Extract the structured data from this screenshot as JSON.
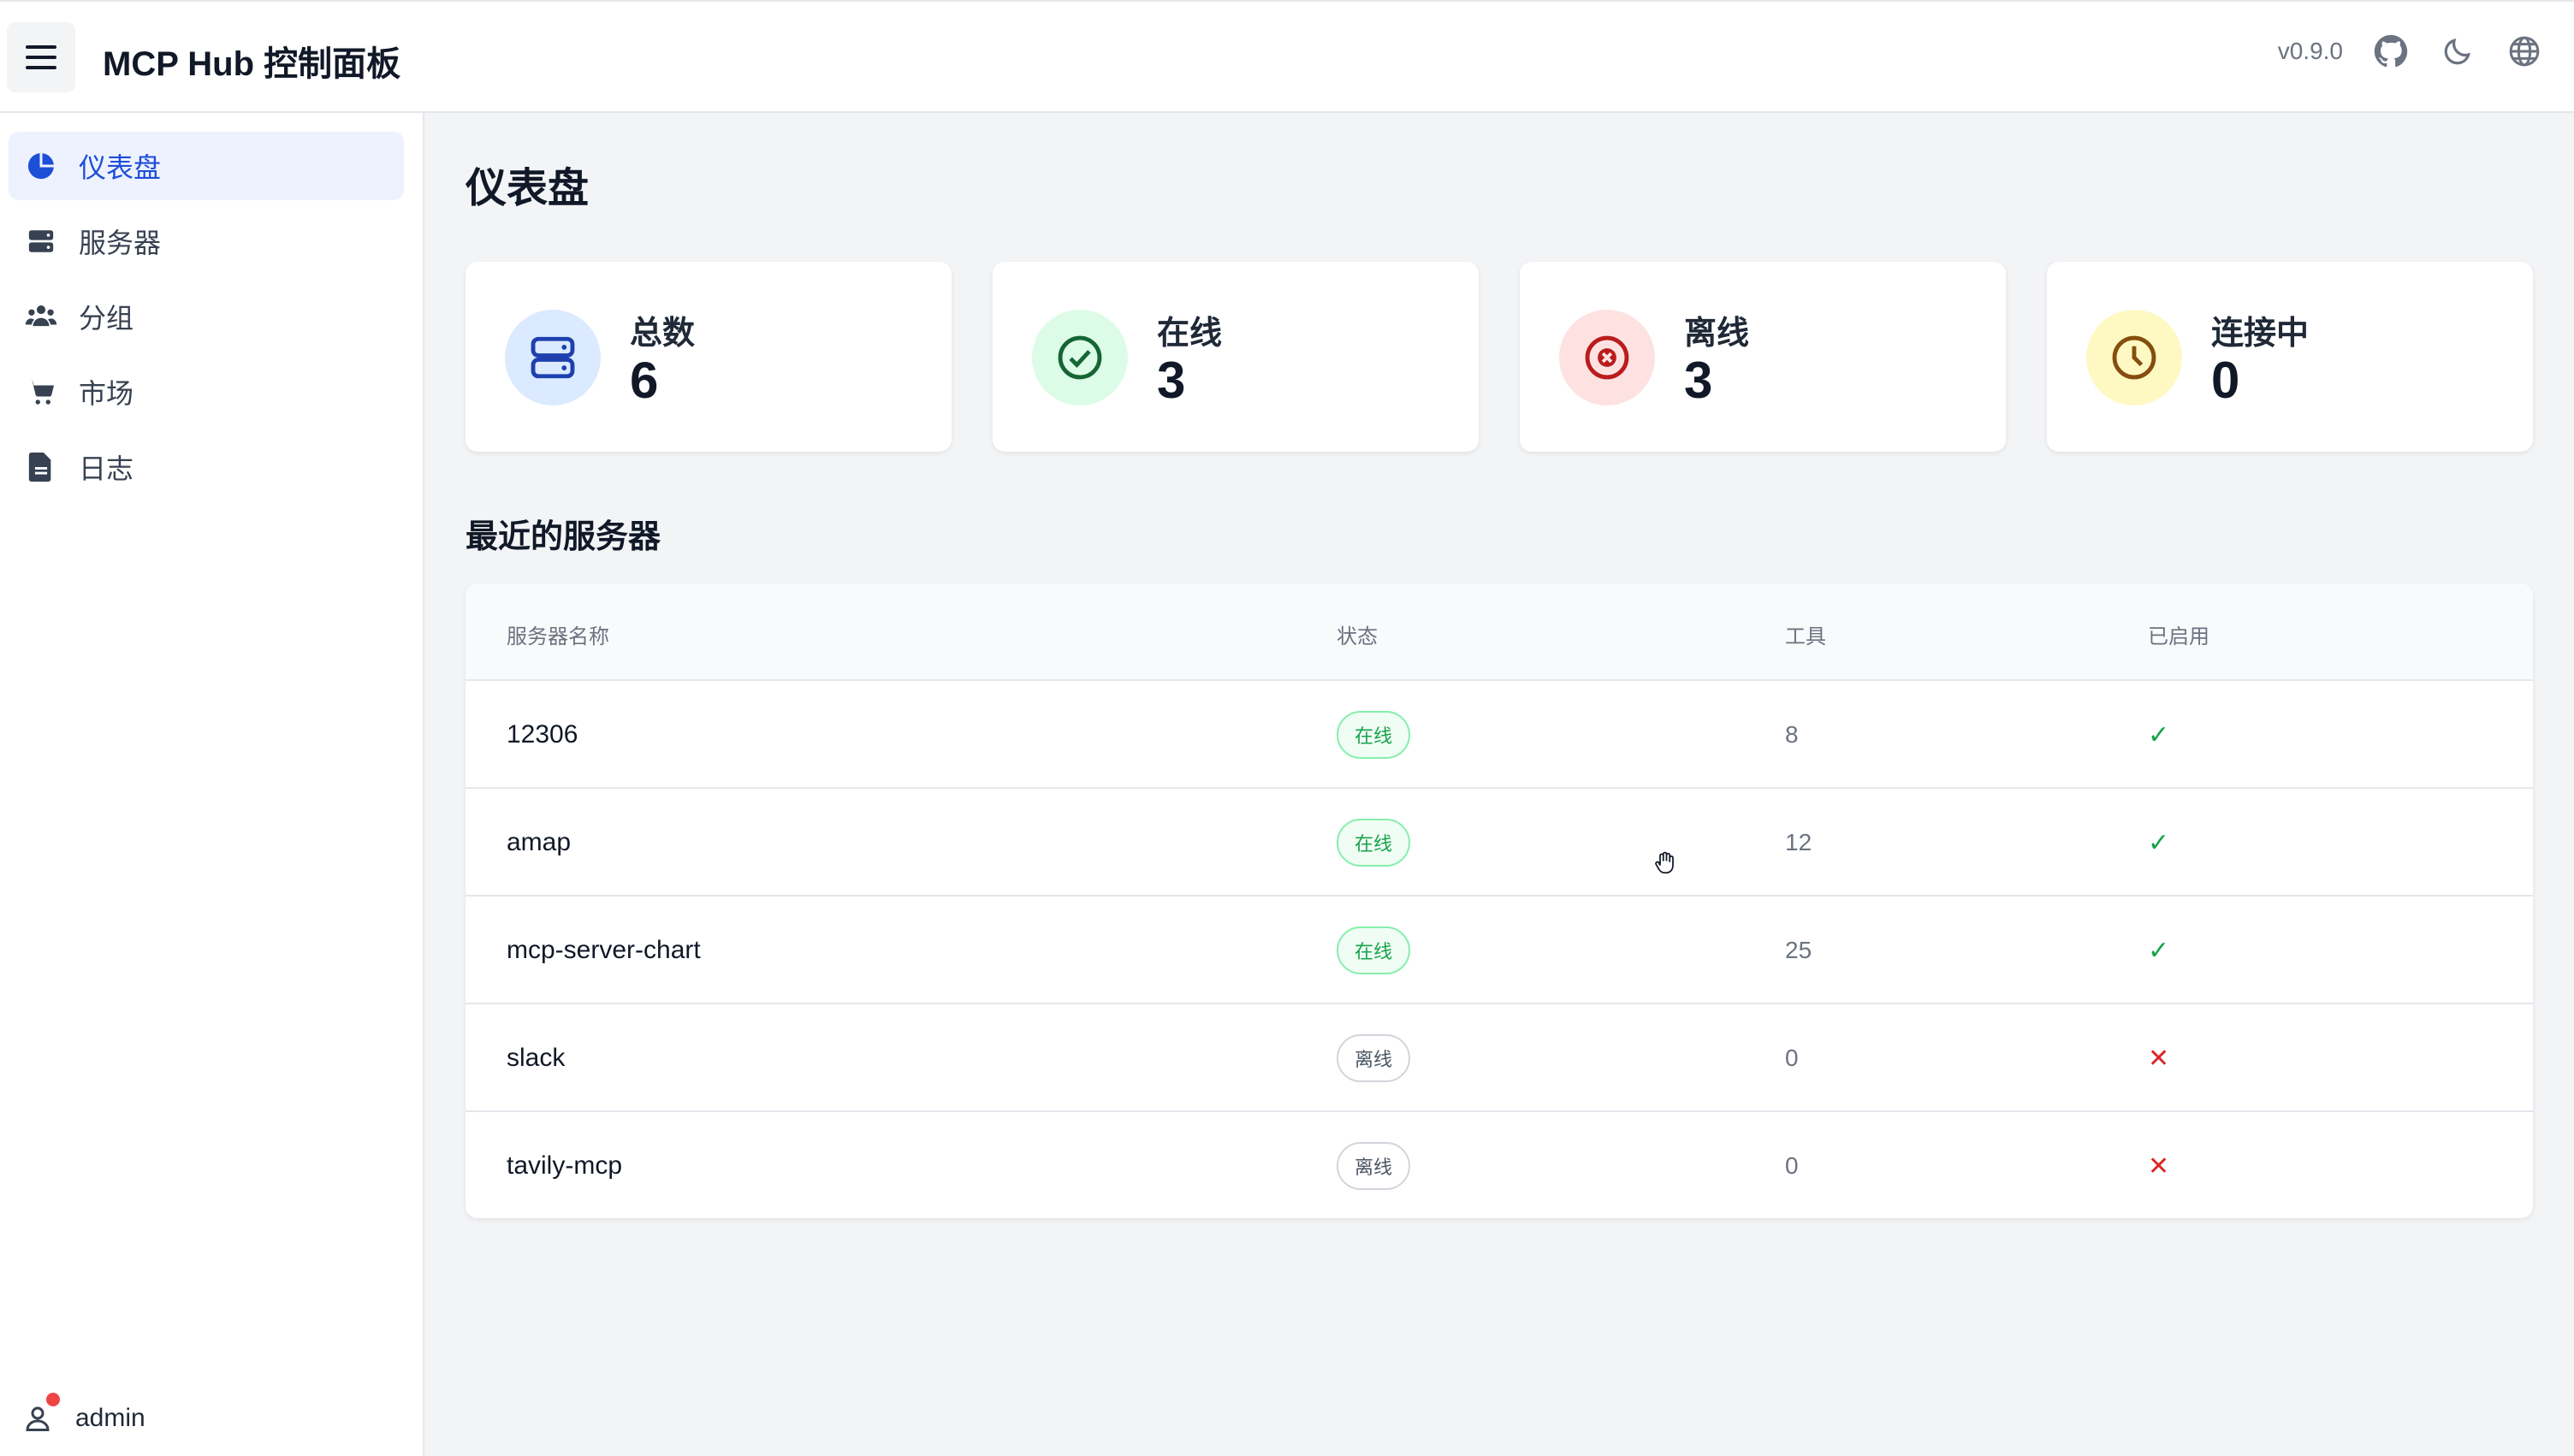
{
  "header": {
    "title": "MCP Hub 控制面板",
    "version": "v0.9.0",
    "icons": [
      "menu-icon",
      "github-icon",
      "moon-icon",
      "globe-icon"
    ]
  },
  "sidebar": {
    "items": [
      {
        "label": "仪表盘",
        "icon": "pie-chart-icon",
        "active": true
      },
      {
        "label": "服务器",
        "icon": "server-icon",
        "active": false
      },
      {
        "label": "分组",
        "icon": "users-icon",
        "active": false
      },
      {
        "label": "市场",
        "icon": "cart-icon",
        "active": false
      },
      {
        "label": "日志",
        "icon": "document-icon",
        "active": false
      }
    ],
    "user": {
      "name": "admin"
    }
  },
  "main": {
    "title": "仪表盘",
    "stats": [
      {
        "label": "总数",
        "value": "6",
        "icon": "server-icon",
        "color": "#1e40af",
        "bg": "#dbeafe"
      },
      {
        "label": "在线",
        "value": "3",
        "icon": "check-circle-icon",
        "color": "#166534",
        "bg": "#dcfce7"
      },
      {
        "label": "离线",
        "value": "3",
        "icon": "x-circle-icon",
        "color": "#b91c1c",
        "bg": "#fee2e2"
      },
      {
        "label": "连接中",
        "value": "0",
        "icon": "clock-icon",
        "color": "#854d0e",
        "bg": "#fef9c3"
      }
    ],
    "recent_title": "最近的服务器",
    "table": {
      "columns": [
        "服务器名称",
        "状态",
        "工具",
        "已启用"
      ],
      "rows": [
        {
          "name": "12306",
          "status": "在线",
          "tools": "8",
          "enabled": "✓"
        },
        {
          "name": "amap",
          "status": "在线",
          "tools": "12",
          "enabled": "✓"
        },
        {
          "name": "mcp-server-chart",
          "status": "在线",
          "tools": "25",
          "enabled": "✓"
        },
        {
          "name": "slack",
          "status": "离线",
          "tools": "0",
          "enabled": "✕"
        },
        {
          "name": "tavily-mcp",
          "status": "离线",
          "tools": "0",
          "enabled": "✕"
        }
      ]
    }
  },
  "colors": {
    "accent": "#1d4ed8",
    "online": "#16a34a",
    "offline": "#4b5563",
    "disabled": "#dc2626"
  }
}
